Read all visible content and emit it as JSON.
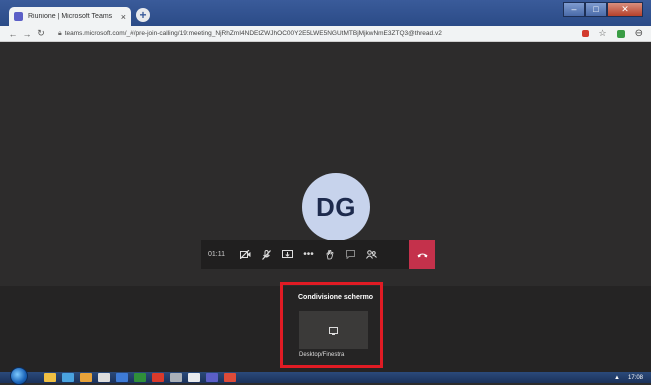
{
  "browser": {
    "tab_title": "Riunione | Microsoft Teams",
    "url": "teams.microsoft.com/_#/pre-join-calling/19:meeting_NjRhZmI4NDEtZWJhOC00Y2E5LWE5NGUtMTBjMjkwNmE3ZTQ3@thread.v2",
    "new_tab_glyph": "+",
    "close_tab_glyph": "×",
    "minimize_glyph": "–",
    "maximize_glyph": "□",
    "close_window_glyph": "✕"
  },
  "call": {
    "avatar_initials": "DG",
    "timer": "01:11",
    "accent_color": "#c4314b"
  },
  "share_tray": {
    "title": "Condivisione schermo",
    "option_label": "Desktop/Finestra",
    "highlight_color": "#e01b24"
  },
  "taskbar": {
    "clock": "17:08",
    "apps": [
      {
        "name": "explorer",
        "color": "#f0c043"
      },
      {
        "name": "media",
        "color": "#4aa3df"
      },
      {
        "name": "app3",
        "color": "#e8a33a"
      },
      {
        "name": "app4",
        "color": "#dddddd"
      },
      {
        "name": "app5",
        "color": "#3e7bd6"
      },
      {
        "name": "app6",
        "color": "#2f8f3a"
      },
      {
        "name": "app7",
        "color": "#d93a2b"
      },
      {
        "name": "app8",
        "color": "#aab0b8"
      },
      {
        "name": "app9",
        "color": "#e8eaed"
      },
      {
        "name": "app10",
        "color": "#5b5fc7"
      },
      {
        "name": "chrome",
        "color": "#dd4b39"
      }
    ]
  }
}
